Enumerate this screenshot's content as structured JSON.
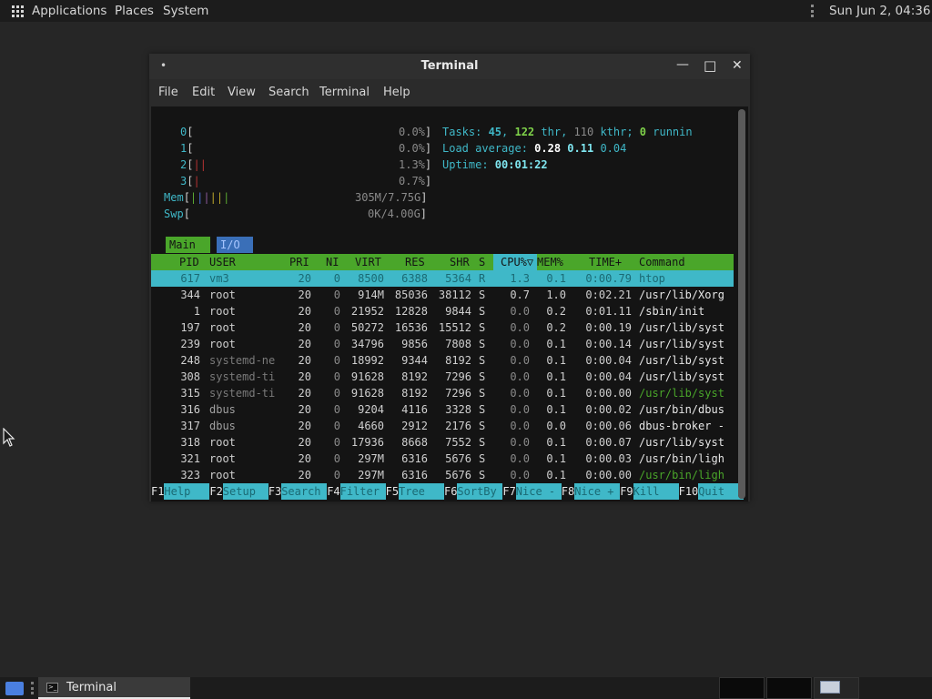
{
  "topbar": {
    "applications": "Applications",
    "places": "Places",
    "system": "System",
    "clock": "Sun Jun  2, 04:36"
  },
  "window": {
    "title_dot": "•",
    "title": "Terminal",
    "minimize": "—",
    "maximize": "□",
    "close": "✕",
    "menu": [
      "File",
      "Edit",
      "View",
      "Search",
      "Terminal",
      "Help"
    ]
  },
  "htop": {
    "cpu": [
      {
        "label": "0",
        "bars": "",
        "pct": "0.0%"
      },
      {
        "label": "1",
        "bars": "",
        "pct": "0.0%"
      },
      {
        "label": "2",
        "bars": "||",
        "pct": "1.3%"
      },
      {
        "label": "3",
        "bars": "|",
        "pct": "0.7%"
      }
    ],
    "mem": {
      "label": "Mem",
      "bars": "||||||",
      "value": "305M/7.75G"
    },
    "swp": {
      "label": "Swp",
      "bars": "",
      "value": "0K/4.00G"
    },
    "tasks": {
      "label": "Tasks: ",
      "count": "45",
      "sep": ", ",
      "thr": "122",
      "thr_label": " thr, ",
      "kthr": "110",
      "kthr_label": " kthr; ",
      "running": "0",
      "running_label": " runnin"
    },
    "load": {
      "label": "Load average: ",
      "one": "0.28",
      "five": "0.11",
      "fifteen": "0.04"
    },
    "uptime": {
      "label": "Uptime: ",
      "value": "00:01:22"
    },
    "tabs": {
      "main": "Main",
      "io": "I/O"
    },
    "columns": [
      "PID",
      "USER",
      "PRI",
      "NI",
      "VIRT",
      "RES",
      "SHR",
      "S",
      "CPU%▽",
      "MEM%",
      "TIME+",
      "Command"
    ],
    "processes": [
      {
        "pid": "617",
        "user": "vm3",
        "pri": "20",
        "ni": "0",
        "virt": "8500",
        "res": "6388",
        "shr": "5364",
        "s": "R",
        "cpu": "1.3",
        "mem": "0.1",
        "time": "0:00.79",
        "cmd": "htop"
      },
      {
        "pid": "344",
        "user": "root",
        "pri": "20",
        "ni": "0",
        "virt": "914M",
        "res": "85036",
        "shr": "38112",
        "s": "S",
        "cpu": "0.7",
        "mem": "1.0",
        "time": "0:02.21",
        "cmd": "/usr/lib/Xorg"
      },
      {
        "pid": "1",
        "user": "root",
        "pri": "20",
        "ni": "0",
        "virt": "21952",
        "res": "12828",
        "shr": "9844",
        "s": "S",
        "cpu": "0.0",
        "mem": "0.2",
        "time": "0:01.11",
        "cmd": "/sbin/init"
      },
      {
        "pid": "197",
        "user": "root",
        "pri": "20",
        "ni": "0",
        "virt": "50272",
        "res": "16536",
        "shr": "15512",
        "s": "S",
        "cpu": "0.0",
        "mem": "0.2",
        "time": "0:00.19",
        "cmd": "/usr/lib/syst"
      },
      {
        "pid": "239",
        "user": "root",
        "pri": "20",
        "ni": "0",
        "virt": "34796",
        "res": "9856",
        "shr": "7808",
        "s": "S",
        "cpu": "0.0",
        "mem": "0.1",
        "time": "0:00.14",
        "cmd": "/usr/lib/syst"
      },
      {
        "pid": "248",
        "user": "systemd-ne",
        "pri": "20",
        "ni": "0",
        "virt": "18992",
        "res": "9344",
        "shr": "8192",
        "s": "S",
        "cpu": "0.0",
        "mem": "0.1",
        "time": "0:00.04",
        "cmd": "/usr/lib/syst"
      },
      {
        "pid": "308",
        "user": "systemd-ti",
        "pri": "20",
        "ni": "0",
        "virt": "91628",
        "res": "8192",
        "shr": "7296",
        "s": "S",
        "cpu": "0.0",
        "mem": "0.1",
        "time": "0:00.04",
        "cmd": "/usr/lib/syst"
      },
      {
        "pid": "315",
        "user": "systemd-ti",
        "pri": "20",
        "ni": "0",
        "virt": "91628",
        "res": "8192",
        "shr": "7296",
        "s": "S",
        "cpu": "0.0",
        "mem": "0.1",
        "time": "0:00.00",
        "cmd": "/usr/lib/syst",
        "thread": true
      },
      {
        "pid": "316",
        "user": "dbus",
        "pri": "20",
        "ni": "0",
        "virt": "9204",
        "res": "4116",
        "shr": "3328",
        "s": "S",
        "cpu": "0.0",
        "mem": "0.1",
        "time": "0:00.02",
        "cmd": "/usr/bin/dbus"
      },
      {
        "pid": "317",
        "user": "dbus",
        "pri": "20",
        "ni": "0",
        "virt": "4660",
        "res": "2912",
        "shr": "2176",
        "s": "S",
        "cpu": "0.0",
        "mem": "0.0",
        "time": "0:00.06",
        "cmd": "dbus-broker -"
      },
      {
        "pid": "318",
        "user": "root",
        "pri": "20",
        "ni": "0",
        "virt": "17936",
        "res": "8668",
        "shr": "7552",
        "s": "S",
        "cpu": "0.0",
        "mem": "0.1",
        "time": "0:00.07",
        "cmd": "/usr/lib/syst"
      },
      {
        "pid": "321",
        "user": "root",
        "pri": "20",
        "ni": "0",
        "virt": "297M",
        "res": "6316",
        "shr": "5676",
        "s": "S",
        "cpu": "0.0",
        "mem": "0.1",
        "time": "0:00.03",
        "cmd": "/usr/bin/ligh"
      },
      {
        "pid": "323",
        "user": "root",
        "pri": "20",
        "ni": "0",
        "virt": "297M",
        "res": "6316",
        "shr": "5676",
        "s": "S",
        "cpu": "0.0",
        "mem": "0.1",
        "time": "0:00.00",
        "cmd": "/usr/bin/ligh",
        "thread": true
      }
    ],
    "fkeys": [
      {
        "key": "F1",
        "label": "Help  "
      },
      {
        "key": "F2",
        "label": "Setup "
      },
      {
        "key": "F3",
        "label": "Search"
      },
      {
        "key": "F4",
        "label": "Filter"
      },
      {
        "key": "F5",
        "label": "Tree  "
      },
      {
        "key": "F6",
        "label": "SortBy"
      },
      {
        "key": "F7",
        "label": "Nice -"
      },
      {
        "key": "F8",
        "label": "Nice +"
      },
      {
        "key": "F9",
        "label": "Kill  "
      },
      {
        "key": "F10",
        "label": "Quit  "
      }
    ]
  },
  "taskbar": {
    "terminal_label": "Terminal",
    "terminal_icon_glyph": ">_"
  },
  "colors": {
    "accent_green": "#4aa62a",
    "accent_cyan": "#3fb8c8",
    "background": "#262626"
  }
}
